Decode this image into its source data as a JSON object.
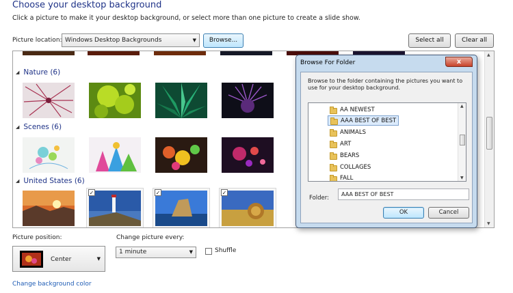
{
  "header": {
    "title": "Choose your desktop background",
    "subtitle": "Click a picture to make it your desktop background, or select more than one picture to create a slide show."
  },
  "location": {
    "label": "Picture location:",
    "selected": "Windows Desktop Backgrounds",
    "browse_label": "Browse...",
    "select_all_label": "Select all",
    "clear_all_label": "Clear all"
  },
  "gallery": {
    "groups": [
      {
        "title": "Nature (6)"
      },
      {
        "title": "Scenes (6)"
      },
      {
        "title": "United States (6)"
      }
    ]
  },
  "position": {
    "label": "Picture position:",
    "selected": "Center"
  },
  "interval": {
    "label": "Change picture every:",
    "selected": "1 minute",
    "shuffle_label": "Shuffle"
  },
  "change_bg_link": "Change background color",
  "dialog": {
    "title": "Browse For Folder",
    "close_label": "x",
    "message": "Browse to the folder containing the pictures you want to use for your desktop background.",
    "folders": [
      "AA NEWEST",
      "AAA BEST OF BEST",
      "ANIMALS",
      "ART",
      "BEARS",
      "COLLAGES",
      "FALL"
    ],
    "selected_folder": "AAA BEST OF BEST",
    "folder_label": "Folder:",
    "folder_value": "AAA BEST OF BEST",
    "ok_label": "OK",
    "cancel_label": "Cancel"
  },
  "colors": {
    "title_blue": "#1e3287",
    "link_blue": "#1c5ab4",
    "selection": "#dcebfc"
  }
}
